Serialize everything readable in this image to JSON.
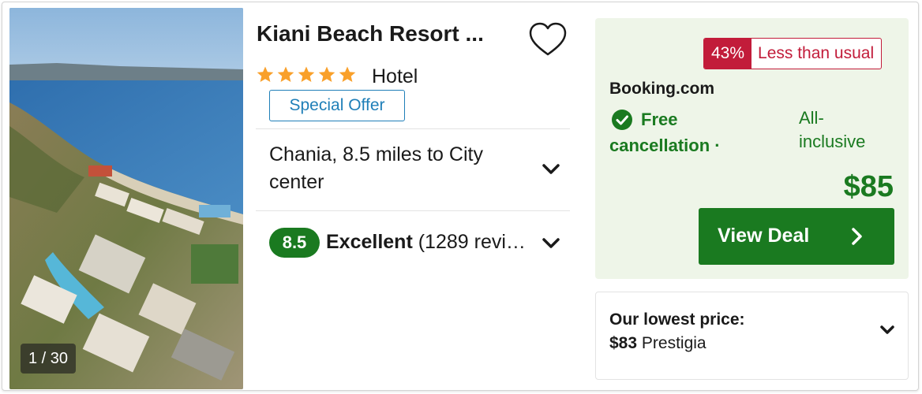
{
  "photo": {
    "counter": "1 / 30",
    "alt": "Aerial view of resort by the sea"
  },
  "hotel": {
    "name": "Kiani Beach Resort ...",
    "star_count": 5,
    "type": "Hotel",
    "special_offer": "Special Offer",
    "location": "Chania, 8.5 miles to City center",
    "rating_score": "8.5",
    "rating_word": "Excellent",
    "rating_reviews": "(1289 reviews)"
  },
  "deal": {
    "discount_pct": "43%",
    "discount_label": "Less than usual",
    "provider": "Booking.com",
    "cancellation_line1": "Free",
    "cancellation_line2": "cancellation",
    "board_line1": "All-",
    "board_line2": "inclusive",
    "price": "$85",
    "button_label": "View Deal"
  },
  "lowest": {
    "title": "Our lowest price:",
    "price": "$83",
    "provider": "Prestigia"
  },
  "colors": {
    "green": "#1a7a20",
    "red": "#c21c3a",
    "blue": "#1f7fb8",
    "star": "#f9a02a",
    "deal_bg": "#eef5e8"
  },
  "icons": {
    "favorite": "heart-outline-icon",
    "expand": "chevron-down-icon",
    "check": "check-circle-icon",
    "go": "chevron-right-icon",
    "star": "star-icon"
  }
}
